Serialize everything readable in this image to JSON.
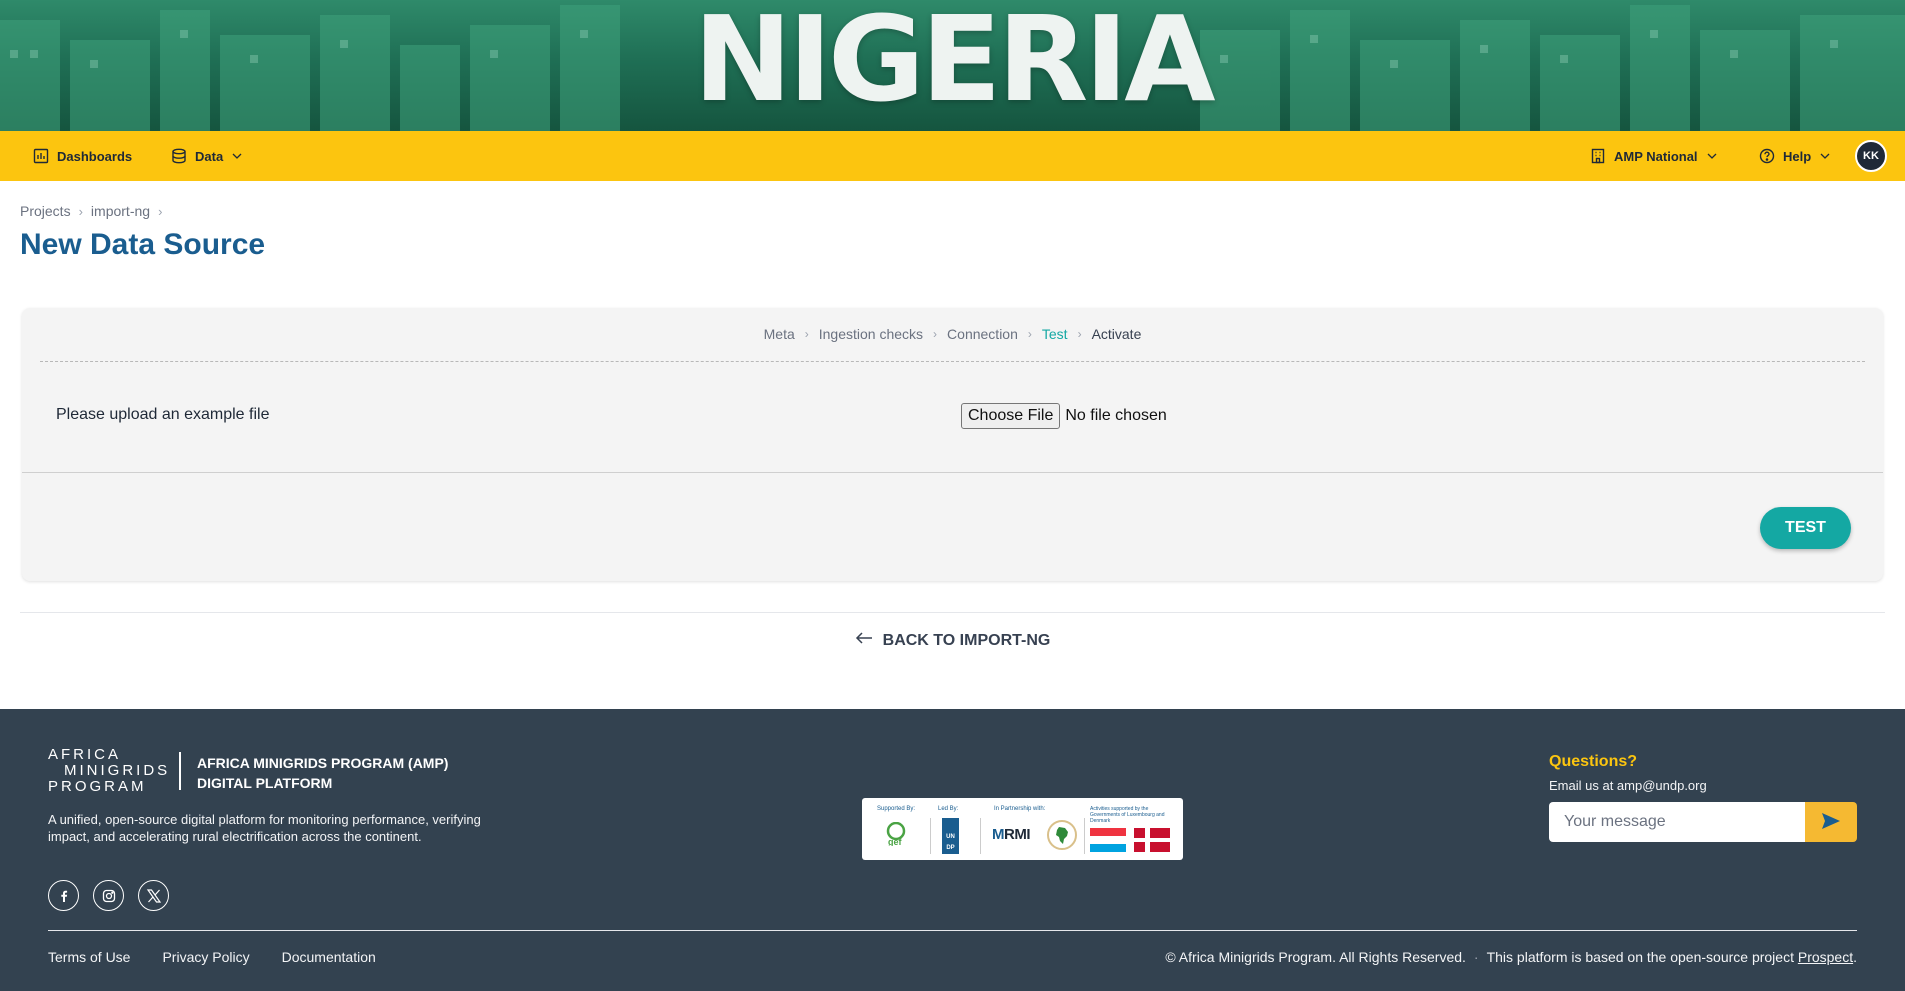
{
  "banner": {
    "title": "NIGERIA"
  },
  "nav": {
    "dashboards": "Dashboards",
    "data": "Data",
    "org": "AMP National",
    "help": "Help",
    "avatar_initials": "KK"
  },
  "breadcrumb": [
    "Projects",
    "import-ng"
  ],
  "page_title": "New Data Source",
  "wizard": {
    "steps": [
      {
        "label": "Meta",
        "state": "done"
      },
      {
        "label": "Ingestion checks",
        "state": "done"
      },
      {
        "label": "Connection",
        "state": "done"
      },
      {
        "label": "Test",
        "state": "active"
      },
      {
        "label": "Activate",
        "state": "upcoming"
      }
    ],
    "upload_label": "Please upload an example file",
    "choose_file": "Choose File",
    "no_file": "No file chosen",
    "test_button": "TEST"
  },
  "back_link": "BACK TO IMPORT-NG",
  "footer": {
    "logo_lines": [
      "AFRICA",
      "MINIGRIDS",
      "PROGRAM"
    ],
    "program_name_1": "AFRICA MINIGRIDS PROGRAM (AMP)",
    "program_name_2": "DIGITAL PLATFORM",
    "description": "A unified, open-source digital platform for monitoring performance, verifying impact, and accelerating rural electrification across the continent.",
    "partners": {
      "supported_by": "Supported By:",
      "led_by": "Led By:",
      "partnership": "In Partnership with:",
      "activities": "Activities supported by the Governments of Luxembourg and Denmark",
      "gef": "gef",
      "undp": "UN DP",
      "rmi": "RMI"
    },
    "questions_title": "Questions?",
    "questions_email": "Email us at amp@undp.org",
    "message_placeholder": "Your message",
    "links": [
      "Terms of Use",
      "Privacy Policy",
      "Documentation"
    ],
    "copyright": "© Africa Minigrids Program. All Rights Reserved.",
    "based_on": "This platform is based on the open-source project",
    "prospect": "Prospect",
    "period": "."
  },
  "colors": {
    "accent_teal": "#14a8a3",
    "nav_yellow": "#fcc50f",
    "title_blue": "#1a5d8f",
    "footer_bg": "#334250"
  },
  "icons": [
    "chart-icon",
    "database-icon",
    "building-icon",
    "help-icon",
    "chevron-down-icon",
    "arrow-left-icon",
    "facebook-icon",
    "instagram-icon",
    "x-icon",
    "send-icon"
  ]
}
